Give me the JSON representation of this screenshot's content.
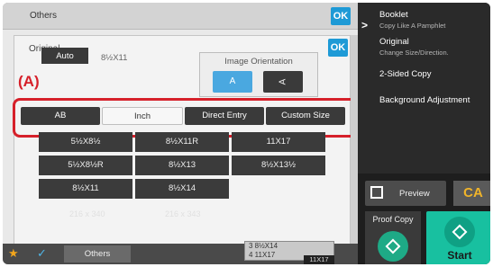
{
  "window": {
    "title": "Others",
    "ok_label": "OK"
  },
  "dialog": {
    "title": "Original",
    "ok_label": "OK",
    "image_orientation": {
      "label": "Image Orientation",
      "portrait": "A",
      "landscape": "A"
    },
    "auto_label": "Auto",
    "current_size": "8½X11"
  },
  "callout": "(A)",
  "tabs": [
    "AB",
    "Inch",
    "Direct Entry",
    "Custom Size"
  ],
  "selected_tab": "Inch",
  "sizes": [
    [
      "5½X8½",
      "8½X11R",
      "11X17"
    ],
    [
      "5½X8½R",
      "8½X13",
      "8½X13½"
    ],
    [
      "8½X11",
      "8½X14"
    ]
  ],
  "ghost_text": [
    "216 x 340",
    "216 x 343"
  ],
  "bottom": {
    "others_label": "Others"
  },
  "queue": {
    "line1": "3   8½X14",
    "line2": "4   11X17",
    "tag": "11X17"
  },
  "sidebar": {
    "items": [
      {
        "title": "Booklet",
        "subtitle": "Copy Like A Pamphlet"
      },
      {
        "title": "Original",
        "subtitle": "Change Size/Direction."
      },
      {
        "title": "2-Sided Copy",
        "subtitle": ""
      },
      {
        "title": "Background Adjustment",
        "subtitle": ""
      }
    ]
  },
  "actions": {
    "preview_label": "Preview",
    "ca_label": "CA",
    "proof_label": "Proof Copy",
    "start_label": "Start"
  },
  "colors": {
    "accent_blue": "#1e9ad6",
    "start_green": "#18c0a0",
    "callout_red": "#d6202a",
    "ca_orange": "#f0b42a"
  }
}
